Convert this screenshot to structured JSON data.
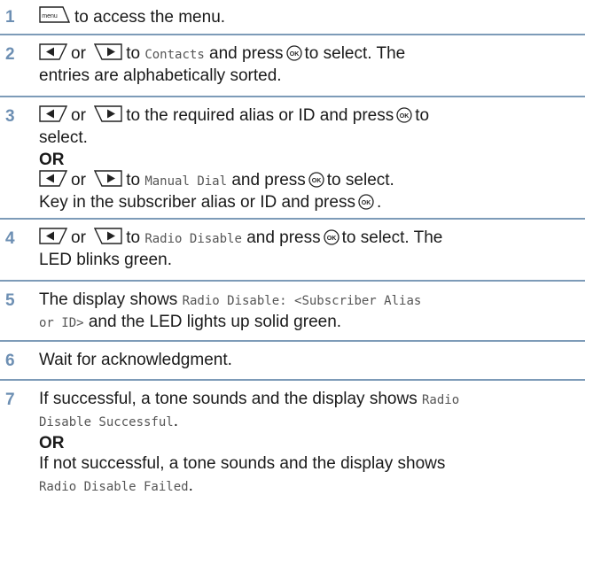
{
  "steps": [
    {
      "number": "1",
      "menu_key": "menu",
      "text": "to access the menu."
    },
    {
      "number": "2",
      "or": "or",
      "to": "to",
      "item": "Contacts",
      "press": "and press",
      "select": "to select. The",
      "line2": "entries are alphabetically sorted."
    },
    {
      "number": "3",
      "or": "or",
      "to": "to the required alias or ID and press",
      "select_to": "to",
      "line2": "select.",
      "or_heading": "OR",
      "alt_to": "to",
      "alt_item": "Manual Dial",
      "alt_press": "and press",
      "alt_select": "to select.",
      "line5": "Key in the subscriber alias or ID and press",
      "period": "."
    },
    {
      "number": "4",
      "or": "or",
      "to": "to",
      "item": "Radio Disable",
      "press": "and press",
      "select": "to select. The",
      "line2": "LED blinks green."
    },
    {
      "number": "5",
      "text": "The display shows",
      "mono1": "Radio Disable: <Subscriber Alias",
      "mono2": "or ID>",
      "text2": "and the LED lights up solid green."
    },
    {
      "number": "6",
      "text": "Wait for acknowledgment."
    },
    {
      "number": "7",
      "text": "If successful, a tone sounds and the display shows",
      "mono1": "Radio",
      "mono2": "Disable Successful",
      "period": ".",
      "or_heading": "OR",
      "text3": "If not successful, a tone sounds and the display shows",
      "mono3": "Radio Disable Failed",
      "period2": "."
    }
  ],
  "colors": {
    "step_number": "#6d8fb3",
    "rule": "#7d9bb8"
  },
  "icons": [
    "menu-key-icon",
    "left-arrow-key-icon",
    "right-arrow-key-icon",
    "ok-key-icon"
  ]
}
